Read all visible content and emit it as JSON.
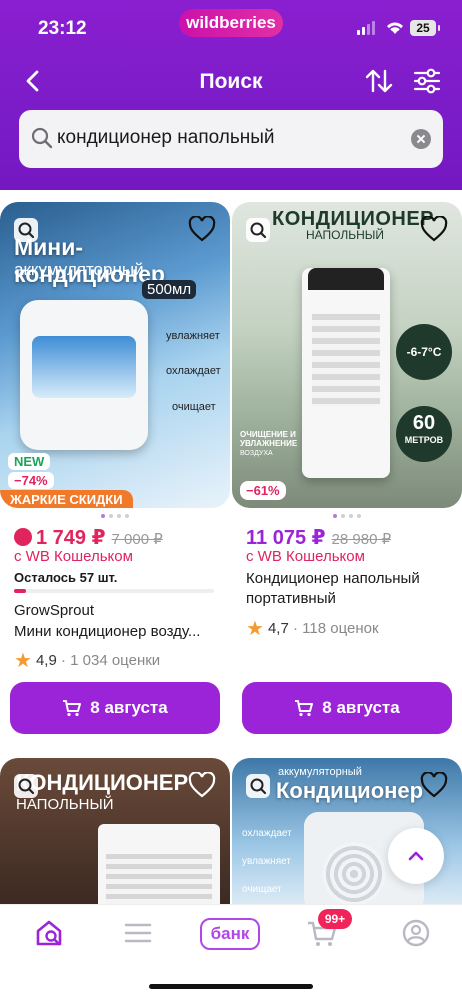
{
  "status": {
    "time": "23:12",
    "battery": "25"
  },
  "brand": {
    "logo": "wildberries"
  },
  "nav": {
    "title": "Поиск",
    "back_icon": "chevron-left-icon",
    "sort_icon": "sort-arrows-icon",
    "filter_icon": "sliders-icon"
  },
  "search": {
    "value": "кондиционер напольный"
  },
  "products": [
    {
      "overlay_title": "Мини-кондиционер",
      "overlay_subtitle": "аккумуляторный",
      "overlay_tags": [
        "500мл",
        "увлажняет",
        "охлаждает",
        "очищает"
      ],
      "new_badge": "NEW",
      "discount": "−74%",
      "promo": "ЖАРКИЕ СКИДКИ",
      "price": "1 749 ₽",
      "old_price": "7 000 ₽",
      "wallet": "с WB Кошельком",
      "stock": "Осталось 57 шт.",
      "stock_level": 0.06,
      "brand": "GrowSprout",
      "name": "Мини кондиционер возду...",
      "rating": "4,9",
      "reviews": "1 034 оценки",
      "delivery": "8 августа"
    },
    {
      "overlay_title": "КОНДИЦИОНЕР",
      "overlay_subtitle": "НАПОЛЬНЫЙ",
      "overlay_tags": [
        "-6-7°C",
        "60",
        "МЕТРОВ",
        "ОЧИЩЕНИЕ И УВЛАЖНЕНИЕ",
        "ВОЗДУХА"
      ],
      "discount": "−61%",
      "price": "11 075 ₽",
      "old_price": "28 980 ₽",
      "wallet": "с WB Кошельком",
      "name_line1": "Кондиционер напольный",
      "name_line2": "портативный",
      "rating": "4,7",
      "reviews": "118 оценок",
      "delivery": "8 августа"
    },
    {
      "overlay_title": "КОНДИЦИОНЕР",
      "overlay_subtitle": "НАПОЛЬНЫЙ"
    },
    {
      "overlay_title": "Кондиционер",
      "overlay_subtitle": "аккумуляторный",
      "overlay_tags": [
        "охлаждает",
        "увлажняет",
        "очищает"
      ]
    }
  ],
  "tabbar": {
    "bank": "банк",
    "cart_badge": "99+"
  }
}
